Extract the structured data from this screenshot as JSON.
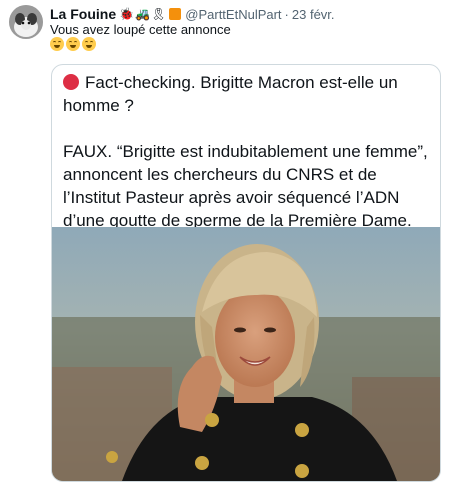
{
  "tweet": {
    "author_name": "La Fouine",
    "handle": "@ParttEtNulPart",
    "separator": "·",
    "date": "23 févr.",
    "text": "Vous avez loupé cette annonce",
    "reaction_emojis": [
      "face-with-hand-over-mouth",
      "face-with-hand-over-mouth",
      "face-with-hand-over-mouth"
    ]
  },
  "embedded_post": {
    "headline": "Fact-checking. Brigitte Macron est-elle un homme ?",
    "body": "FAUX. “Brigitte est indubitablement une femme”, annoncent les chercheurs du CNRS et de l’Institut Pasteur après avoir séquencé l’ADN d’une goutte de sperme de la Première Dame."
  },
  "colors": {
    "name_text": "#0f1419",
    "secondary_text": "#536471",
    "card_border": "#cfd9de",
    "red_circle": "#dd2e44"
  }
}
